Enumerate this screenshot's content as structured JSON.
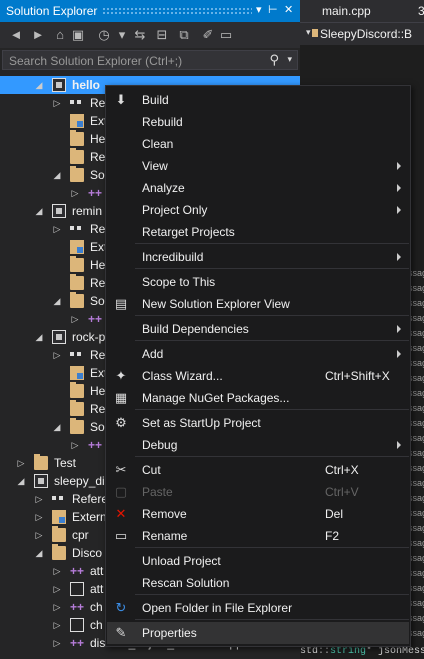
{
  "panel": {
    "title": "Solution Explorer",
    "pin_icon": "pin-icon",
    "close_icon": "close-icon",
    "search_placeholder": "Search Solution Explorer (Ctrl+;)"
  },
  "tree": [
    {
      "label": "hello",
      "selected": true
    },
    {
      "label": "Re"
    },
    {
      "label": "Ext"
    },
    {
      "label": "He"
    },
    {
      "label": "Re"
    },
    {
      "label": "So"
    },
    {
      "label": ""
    },
    {
      "label": "remin"
    },
    {
      "label": "Re"
    },
    {
      "label": "Ext"
    },
    {
      "label": "He"
    },
    {
      "label": "Re"
    },
    {
      "label": "So"
    },
    {
      "label": ""
    },
    {
      "label": "rock-p"
    },
    {
      "label": "Re"
    },
    {
      "label": "Ext"
    },
    {
      "label": "He"
    },
    {
      "label": "Re"
    },
    {
      "label": "So"
    },
    {
      "label": ""
    },
    {
      "label": "Test"
    },
    {
      "label": "sleepy_dis"
    },
    {
      "label": "Refere"
    },
    {
      "label": "Extern"
    },
    {
      "label": "cpr"
    },
    {
      "label": "Disco"
    },
    {
      "label": "att"
    },
    {
      "label": "att"
    },
    {
      "label": "ch"
    },
    {
      "label": "ch"
    },
    {
      "label": "discord_object_interface.cpp"
    }
  ],
  "editor": {
    "tab": "main.cpp",
    "tab_number": "3",
    "breadcrumb": "SleepyDiscord::B",
    "message_snippet": "ssag",
    "code_line": "std::string* jsonMessa"
  },
  "menu": {
    "items": [
      {
        "label": "Build",
        "icon": "build-icon"
      },
      {
        "label": "Rebuild"
      },
      {
        "label": "Clean"
      },
      {
        "label": "View",
        "submenu": true
      },
      {
        "label": "Analyze",
        "submenu": true
      },
      {
        "label": "Project Only",
        "submenu": true
      },
      {
        "label": "Retarget Projects"
      },
      {
        "label": "Incredibuild",
        "submenu": true
      },
      {
        "label": "Scope to This"
      },
      {
        "label": "New Solution Explorer View",
        "icon": "new-view-icon"
      },
      {
        "label": "Build Dependencies",
        "submenu": true
      },
      {
        "label": "Add",
        "submenu": true
      },
      {
        "label": "Class Wizard...",
        "shortcut": "Ctrl+Shift+X",
        "icon": "class-wizard-icon"
      },
      {
        "label": "Manage NuGet Packages...",
        "icon": "nuget-icon"
      },
      {
        "label": "Set as StartUp Project",
        "icon": "gear-icon"
      },
      {
        "label": "Debug",
        "submenu": true
      },
      {
        "label": "Cut",
        "shortcut": "Ctrl+X",
        "icon": "scissors-icon"
      },
      {
        "label": "Paste",
        "shortcut": "Ctrl+V",
        "icon": "paste-icon",
        "disabled": true
      },
      {
        "label": "Remove",
        "shortcut": "Del",
        "icon": "remove-icon"
      },
      {
        "label": "Rename",
        "shortcut": "F2",
        "icon": "rename-icon"
      },
      {
        "label": "Unload Project"
      },
      {
        "label": "Rescan Solution"
      },
      {
        "label": "Open Folder in File Explorer",
        "icon": "refresh-folder-icon"
      },
      {
        "label": "Properties",
        "icon": "wrench-icon",
        "highlighted": true
      }
    ]
  },
  "colors": {
    "accent": "#007acc",
    "selection": "#3399ff",
    "menu_bg": "#1b1b1c",
    "panel_bg": "#252526",
    "remove_red": "#e51400",
    "open_folder_blue": "#3c8ee6"
  }
}
